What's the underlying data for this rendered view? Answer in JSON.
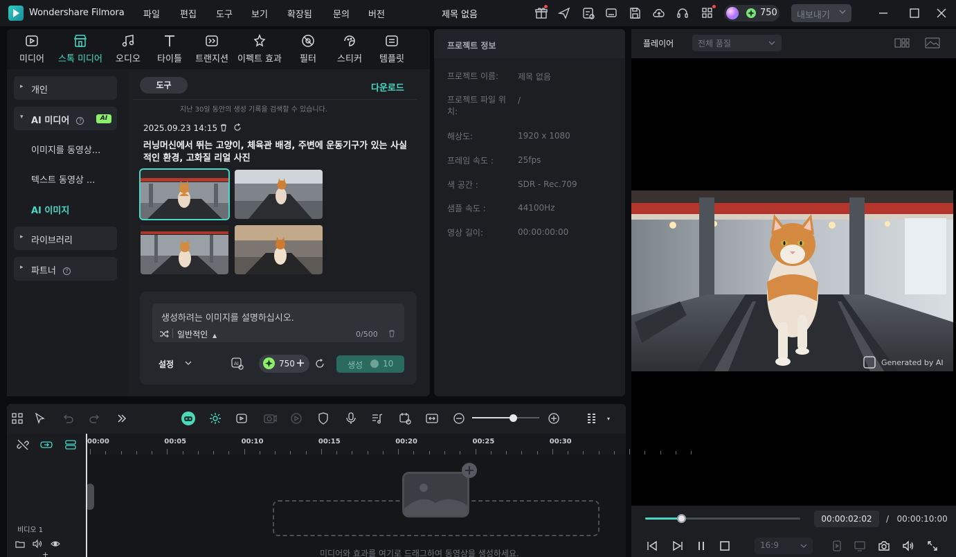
{
  "app": {
    "name": "Wondershare Filmora",
    "document_title": "제목 없음",
    "credits": "750",
    "export_label": "내보내기"
  },
  "menu": [
    "파일",
    "편집",
    "도구",
    "보기",
    "확장됨",
    "문의",
    "버전"
  ],
  "media_tabs": [
    {
      "label": "미디어",
      "icon": "media-icon"
    },
    {
      "label": "스톡 미디어",
      "icon": "stock-media-icon",
      "active": true
    },
    {
      "label": "오디오",
      "icon": "music-note-icon"
    },
    {
      "label": "타이틀",
      "icon": "text-t-icon"
    },
    {
      "label": "트랜지션",
      "icon": "transition-icon"
    },
    {
      "label": "이펙트 효과",
      "icon": "effects-star-icon"
    },
    {
      "label": "필터",
      "icon": "filter-icon"
    },
    {
      "label": "스티커",
      "icon": "sticker-icon"
    },
    {
      "label": "템플릿",
      "icon": "template-icon"
    }
  ],
  "side_nav": {
    "personal": "개인",
    "ai_media": "AI 미디어",
    "ai_badge": "AI",
    "ai_items": [
      "이미지를 동영상...",
      "텍스트 동영상 ...",
      "AI 이미지"
    ],
    "library": "라이브러리",
    "partner": "파트너"
  },
  "gen_panel": {
    "tool_chip": "도구",
    "download": "다운로드",
    "search_hint": "지난 30일 동안의 생성 기록을 검색할 수 있습니다.",
    "date": "2025.09.23 14:15",
    "prompt": "러닝머신에서 뛰는 고양이, 체육관 배경, 주변에 운동기구가 있는 사실적인 환경, 고화질 리얼 사진",
    "input_placeholder": "생성하려는 이미지를 설명하십시오.",
    "style": "일반적인",
    "char_count": "0/500",
    "settings": "설정",
    "cost": "750",
    "generate": "생성",
    "generate_cost": "10"
  },
  "project_info": {
    "title": "프로젝트 정보",
    "rows": [
      {
        "key": "프로젝트 이름:",
        "value": "제목 없음"
      },
      {
        "key": "프로젝트 파일 위치:",
        "value": "/"
      },
      {
        "key": "해상도:",
        "value": "1920 x 1080"
      },
      {
        "key": "프레임 속도 :",
        "value": "25fps"
      },
      {
        "key": "색 공간 :",
        "value": "SDR - Rec.709"
      },
      {
        "key": "샘플 속도 :",
        "value": "44100Hz"
      },
      {
        "key": "영상 길이:",
        "value": "00:00:00:00"
      }
    ]
  },
  "player": {
    "title": "플레이어",
    "quality": "전체 품질",
    "watermark": "Generated by AI",
    "current_time": "00:00:02:02",
    "separator": "/",
    "total_time": "00:00:10:00",
    "progress": 0.2,
    "ratio": "16:9"
  },
  "timeline": {
    "ticks": [
      "00:00",
      "00:05",
      "00:10",
      "00:15",
      "00:20",
      "00:25",
      "00:30"
    ],
    "track_label": "비디오 1",
    "drop_hint": "미디어와 효과를 여기로 드래그하여 동영상을 생성하세요."
  }
}
